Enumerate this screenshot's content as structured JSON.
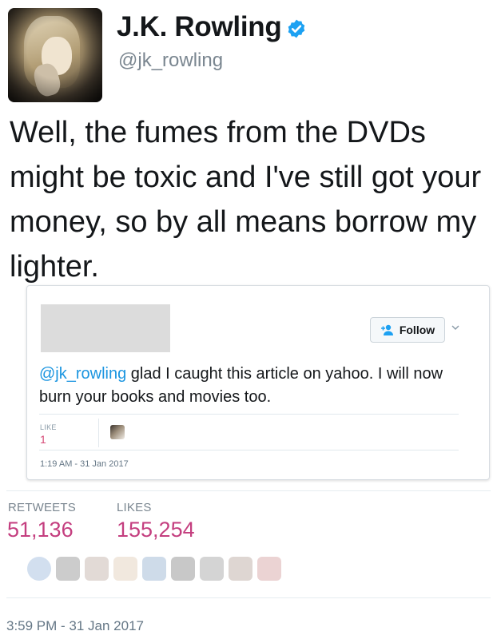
{
  "author": {
    "name": "J.K. Rowling",
    "handle": "@jk_rowling",
    "verified": true,
    "avatar_icon": "profile-photo"
  },
  "tweet": {
    "text": "Well, the fumes from the DVDs might be toxic and I've still got your money, so by all means borrow my lighter."
  },
  "quoted": {
    "follow_label": "Follow",
    "mention": "@jk_rowling",
    "text": " glad I caught this article on yahoo. I will now burn your books and movies too.",
    "like_label": "LIKE",
    "like_count": "1",
    "time": "1:19 AM - 31 Jan 2017"
  },
  "stats": {
    "retweets_label": "RETWEETS",
    "retweets_value": "51,136",
    "likes_label": "LIKES",
    "likes_value": "155,254"
  },
  "timestamp": "3:59 PM - 31 Jan 2017",
  "colors": {
    "accent_blue": "#1b95e0",
    "like_pink": "#c43e7f",
    "verified_blue": "#1da1f2"
  }
}
